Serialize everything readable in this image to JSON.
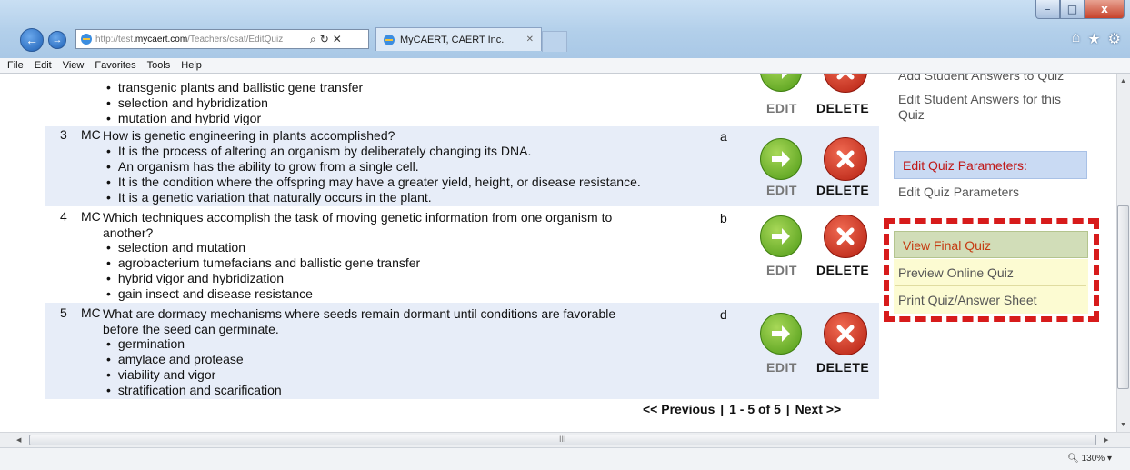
{
  "browser": {
    "url_prefix": "http://test.",
    "url_domain": "mycaert.com",
    "url_path": "/Teachers/csat/EditQuiz",
    "tab_title": "MyCAERT, CAERT Inc.",
    "window_min": "–",
    "window_max": "□",
    "window_close": "x",
    "menu": [
      "File",
      "Edit",
      "View",
      "Favorites",
      "Tools",
      "Help"
    ],
    "zoom": "130%"
  },
  "questions": [
    {
      "number": "",
      "type": "",
      "text": "",
      "answer": "",
      "options": [
        "transgenic plants and ballistic gene transfer",
        "selection and hybridization",
        "mutation and hybrid vigor"
      ]
    },
    {
      "number": "3",
      "type": "MC",
      "text": "How is genetic engineering in plants accomplished?",
      "answer": "a",
      "options": [
        "It is the process of altering an organism by deliberately changing its DNA.",
        "An organism has the ability to grow from a single cell.",
        "It is the condition where the offspring may have a greater yield, height, or disease resistance.",
        "It is a genetic variation that naturally occurs in the plant."
      ]
    },
    {
      "number": "4",
      "type": "MC",
      "text_line1": "Which techniques accomplish the task of moving genetic information from one organism to",
      "text_line2": "another?",
      "answer": "b",
      "options": [
        "selection and mutation",
        "agrobacterium tumefacians and ballistic gene transfer",
        "hybrid vigor and hybridization",
        "gain insect and disease resistance"
      ]
    },
    {
      "number": "5",
      "type": "MC",
      "text_line1": "What are dormacy mechanisms where seeds remain dormant until conditions are favorable",
      "text_line2": "before the seed can germinate.",
      "answer": "d",
      "options": [
        "germination",
        "amylace and protease",
        "viability and vigor",
        "stratification and scarification"
      ]
    }
  ],
  "actions": {
    "edit": "EDIT",
    "delete": "DELETE"
  },
  "pager": {
    "previous": "<< Previous",
    "sep": "|",
    "range": "1 - 5 of 5",
    "next": "Next >>"
  },
  "sidebar": {
    "add_answers_partial": "Add Student Answers to Quiz",
    "edit_answers_line1": "Edit Student Answers for this",
    "edit_answers_line2": "Quiz",
    "param_header": "Edit Quiz Parameters:",
    "edit_params": "Edit Quiz Parameters",
    "view_final": "View Final Quiz",
    "preview_online": "Preview Online Quiz",
    "print_quiz": "Print Quiz/Answer Sheet"
  },
  "colors": {
    "highlight_border": "#d71b1b",
    "header_red": "#c01818",
    "row_bg": "#e7edf8"
  }
}
